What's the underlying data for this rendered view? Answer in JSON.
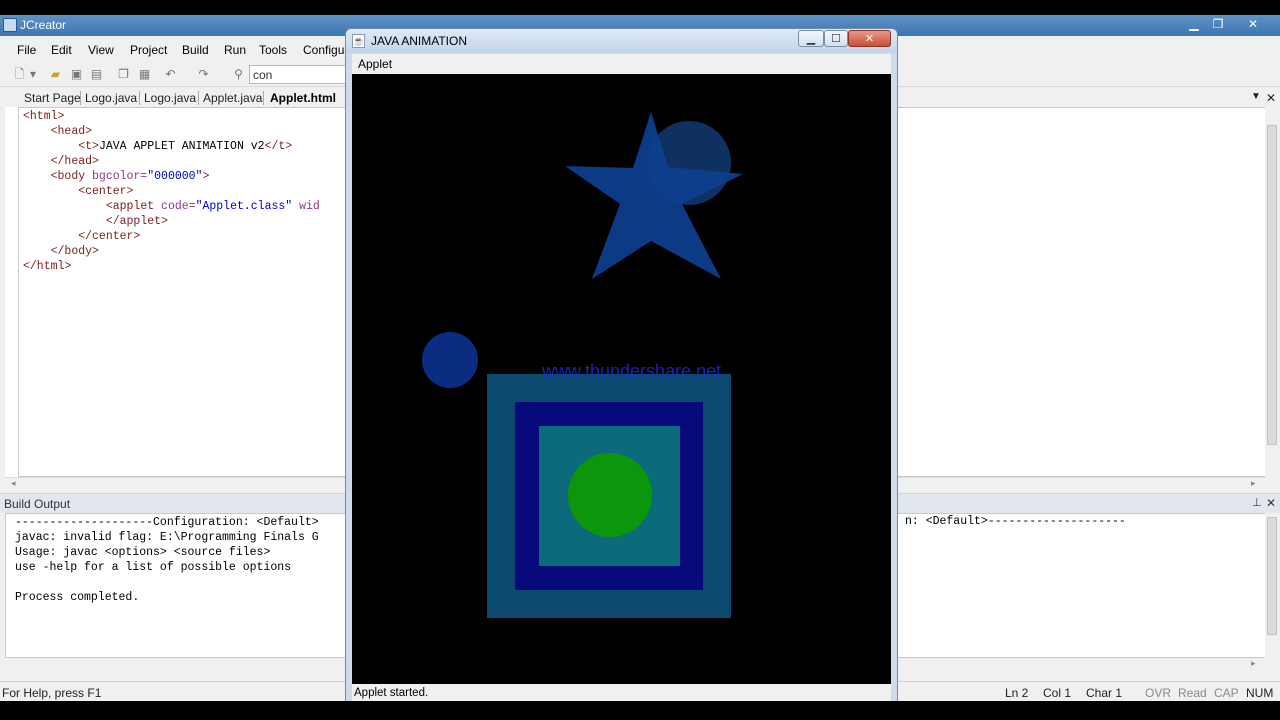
{
  "ide": {
    "title": "JCreator",
    "menu": [
      "File",
      "Edit",
      "View",
      "Project",
      "Build",
      "Run",
      "Tools",
      "Configu"
    ],
    "find_value": "con",
    "tabs": [
      "Start Page",
      "Logo.java",
      "Logo.java",
      "Applet.java",
      "Applet.html"
    ],
    "active_tab": "Applet.html",
    "tab_close": "✕",
    "editor_lines": [
      {
        "indent": "",
        "parts": [
          {
            "c": "kw",
            "t": "<html>"
          }
        ]
      },
      {
        "indent": "    ",
        "parts": [
          {
            "c": "kw",
            "t": "<head>"
          }
        ]
      },
      {
        "indent": "        ",
        "parts": [
          {
            "c": "kw",
            "t": "<t>"
          },
          {
            "c": "tx",
            "t": "JAVA APPLET ANIMATION v2"
          },
          {
            "c": "kw",
            "t": "</t>"
          }
        ]
      },
      {
        "indent": "    ",
        "parts": [
          {
            "c": "kw",
            "t": "</head>"
          }
        ]
      },
      {
        "indent": "    ",
        "parts": [
          {
            "c": "kw",
            "t": "<body "
          },
          {
            "c": "att",
            "t": "bgcolor="
          },
          {
            "c": "val",
            "t": "\"000000\""
          },
          {
            "c": "kw",
            "t": ">"
          }
        ]
      },
      {
        "indent": "        ",
        "parts": [
          {
            "c": "kw",
            "t": "<center>"
          }
        ]
      },
      {
        "indent": "            ",
        "parts": [
          {
            "c": "kw",
            "t": "<applet "
          },
          {
            "c": "att",
            "t": "code="
          },
          {
            "c": "val",
            "t": "\"Applet.class\""
          },
          {
            "c": "att",
            "t": " wid"
          }
        ]
      },
      {
        "indent": "            ",
        "parts": [
          {
            "c": "kw",
            "t": "</applet>"
          }
        ]
      },
      {
        "indent": "        ",
        "parts": [
          {
            "c": "kw",
            "t": "</center>"
          }
        ]
      },
      {
        "indent": "    ",
        "parts": [
          {
            "c": "kw",
            "t": "</body>"
          }
        ]
      },
      {
        "indent": "",
        "parts": [
          {
            "c": "kw",
            "t": "</html>"
          }
        ]
      }
    ],
    "build_output_title": "Build Output",
    "build_output_lines": [
      "--------------------Configuration: <Default>",
      "javac: invalid flag: E:\\Programming Finals G",
      "Usage: javac <options> <source files>",
      "use -help for a list of possible options",
      "",
      "Process completed."
    ],
    "build_output_right": "n: <Default>--------------------",
    "status": {
      "help": "For Help, press F1",
      "ln": "Ln 2",
      "col": "Col 1",
      "char": "Char 1",
      "ovr": "OVR",
      "read": "Read",
      "cap": "CAP",
      "num": "NUM"
    }
  },
  "applet": {
    "title": "JAVA ANIMATION",
    "menu": "Applet",
    "status": "Applet started.",
    "watermark": "www.thundershare.net",
    "colors": {
      "star": "#0d3f8f",
      "circle_behind_star": "#123a72",
      "small_circle": "#0a2d82",
      "outer_square": "#0b4a6e",
      "mid_square": "#060a7a",
      "inner_square": "#0b6b7a",
      "green_circle": "#0c960c",
      "watermark": "#1a2fd6"
    }
  }
}
